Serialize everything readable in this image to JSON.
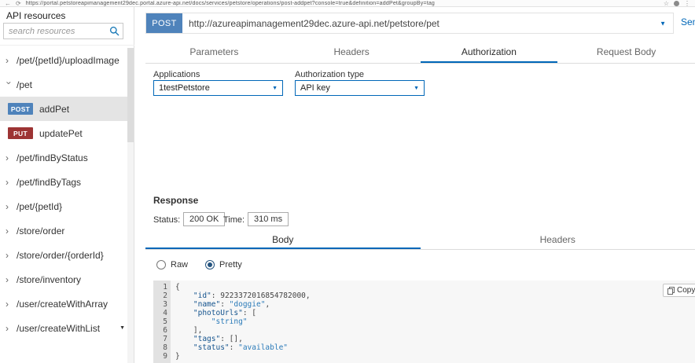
{
  "colors": {
    "accent": "#0067b8",
    "post_badge": "#4f83bb",
    "put_badge": "#9d3434",
    "selected_row": "#e4e4e4"
  },
  "icons": {
    "back": "←",
    "reload": "⟳",
    "star": "☆",
    "menu": "⋮",
    "chevron": "›",
    "caret_down": "▼",
    "search": "magnifier-shape",
    "copy": "overlapping-squares"
  },
  "browser": {
    "url": "https://portal.petstoreapimanagement29dec.portal.azure-api.net/docs/services/petstore/operations/post-addpet?console=true&definition=addPet&groupBy=tag"
  },
  "sidebar": {
    "title": "API resources",
    "search_placeholder": "search resources",
    "items": [
      {
        "type": "path",
        "label": "/pet/{petId}/uploadImage",
        "state": "collapsed"
      },
      {
        "type": "path",
        "label": "/pet",
        "state": "expanded"
      },
      {
        "type": "operation",
        "method": "POST",
        "label": "addPet",
        "selected": true
      },
      {
        "type": "operation",
        "method": "PUT",
        "label": "updatePet",
        "selected": false
      },
      {
        "type": "path",
        "label": "/pet/findByStatus",
        "state": "collapsed"
      },
      {
        "type": "path",
        "label": "/pet/findByTags",
        "state": "collapsed"
      },
      {
        "type": "path",
        "label": "/pet/{petId}",
        "state": "collapsed"
      },
      {
        "type": "path",
        "label": "/store/order",
        "state": "collapsed"
      },
      {
        "type": "path",
        "label": "/store/order/{orderId}",
        "state": "collapsed"
      },
      {
        "type": "path",
        "label": "/store/inventory",
        "state": "collapsed"
      },
      {
        "type": "path",
        "label": "/user/createWithArray",
        "state": "collapsed"
      },
      {
        "type": "path",
        "label": "/user/createWithList",
        "state": "collapsed",
        "trailing_caret": true
      }
    ]
  },
  "request": {
    "method": "POST",
    "url": "http://azureapimanagement29dec.azure-api.net/petstore/pet",
    "send_label": "Send",
    "tabs": [
      {
        "label": "Parameters",
        "selected": false
      },
      {
        "label": "Headers",
        "selected": false
      },
      {
        "label": "Authorization",
        "selected": true
      },
      {
        "label": "Request Body",
        "selected": false
      }
    ]
  },
  "authorization": {
    "applications_label": "Applications",
    "applications_value": "1testPetstore",
    "auth_type_label": "Authorization type",
    "auth_type_value": "API key"
  },
  "response": {
    "title": "Response",
    "status_label": "Status:",
    "status_value": "200 OK",
    "time_label": "Time:",
    "time_value": "310 ms",
    "tabs": [
      {
        "label": "Body",
        "selected": true
      },
      {
        "label": "Headers",
        "selected": false
      }
    ],
    "raw_label": "Raw",
    "pretty_label": "Pretty",
    "copy_label": "Copy",
    "code_lines": [
      {
        "n": 1,
        "tokens": [
          {
            "t": "p",
            "v": "{"
          }
        ]
      },
      {
        "n": 2,
        "tokens": [
          {
            "t": "p",
            "v": "    "
          },
          {
            "t": "k",
            "v": "\"id\""
          },
          {
            "t": "p",
            "v": ": "
          },
          {
            "t": "num",
            "v": "9223372016854782000"
          },
          {
            "t": "p",
            "v": ","
          }
        ]
      },
      {
        "n": 3,
        "tokens": [
          {
            "t": "p",
            "v": "    "
          },
          {
            "t": "k",
            "v": "\"name\""
          },
          {
            "t": "p",
            "v": ": "
          },
          {
            "t": "s",
            "v": "\"doggie\""
          },
          {
            "t": "p",
            "v": ","
          }
        ]
      },
      {
        "n": 4,
        "tokens": [
          {
            "t": "p",
            "v": "    "
          },
          {
            "t": "k",
            "v": "\"photoUrls\""
          },
          {
            "t": "p",
            "v": ": "
          },
          {
            "t": "p",
            "v": "["
          }
        ]
      },
      {
        "n": 5,
        "tokens": [
          {
            "t": "p",
            "v": "        "
          },
          {
            "t": "s",
            "v": "\"string\""
          }
        ]
      },
      {
        "n": 6,
        "tokens": [
          {
            "t": "p",
            "v": "    "
          },
          {
            "t": "p",
            "v": "],"
          }
        ]
      },
      {
        "n": 7,
        "tokens": [
          {
            "t": "p",
            "v": "    "
          },
          {
            "t": "k",
            "v": "\"tags\""
          },
          {
            "t": "p",
            "v": ": "
          },
          {
            "t": "p",
            "v": "[],"
          }
        ]
      },
      {
        "n": 8,
        "tokens": [
          {
            "t": "p",
            "v": "    "
          },
          {
            "t": "k",
            "v": "\"status\""
          },
          {
            "t": "p",
            "v": ": "
          },
          {
            "t": "s",
            "v": "\"available\""
          }
        ]
      },
      {
        "n": 9,
        "tokens": [
          {
            "t": "p",
            "v": "}"
          }
        ]
      }
    ]
  }
}
